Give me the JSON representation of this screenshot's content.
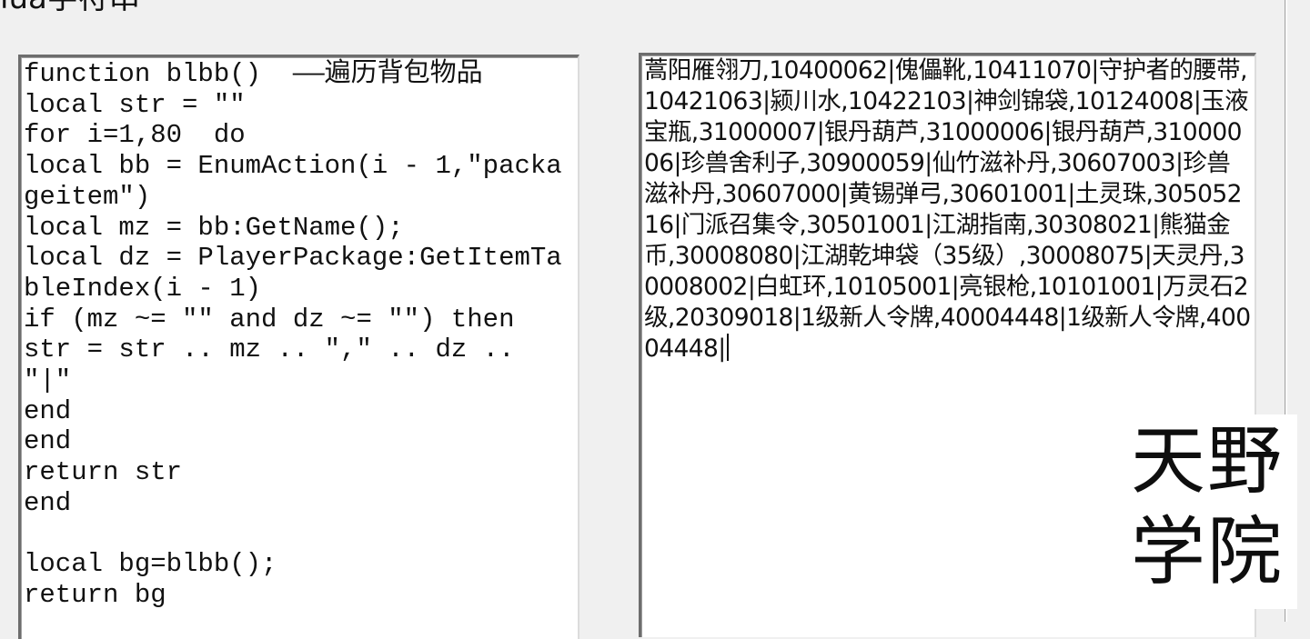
{
  "window": {
    "group_title": "lua字符串"
  },
  "code_editor": {
    "content": "function blbb()  ——遍历背包物品\nlocal str = \"\"\nfor i=1,80  do\nlocal bb = EnumAction(i - 1,\"packageitem\")\nlocal mz = bb:GetName();\nlocal dz = PlayerPackage:GetItemTableIndex(i - 1)\nif (mz ~= \"\" and dz ~= \"\") then\nstr = str .. mz .. \",\" .. dz .. \"|\"\nend\nend\nreturn str\nend\n\nlocal bg=blbb();\nreturn bg"
  },
  "result_box": {
    "content": "蒿阳雁翎刀,10400062|傀儡靴,10411070|守护者的腰带,10421063|颍川水,10422103|神剑锦袋,10124008|玉液宝瓶,31000007|银丹葫芦,31000006|银丹葫芦,31000006|珍兽舍利子,30900059|仙竹滋补丹,30607003|珍兽滋补丹,30607000|黄锡弹弓,30601001|土灵珠,30505216|门派召集令,30501001|江湖指南,30308021|熊猫金币,30008080|江湖乾坤袋（35级）,30008075|天灵丹,30008002|白虹环,10105001|亮银枪,10101001|万灵石2级,20309018|1级新人令牌,40004448|1级新人令牌,40004448|"
  },
  "watermark": {
    "line1": "天野",
    "line2": "学院"
  }
}
